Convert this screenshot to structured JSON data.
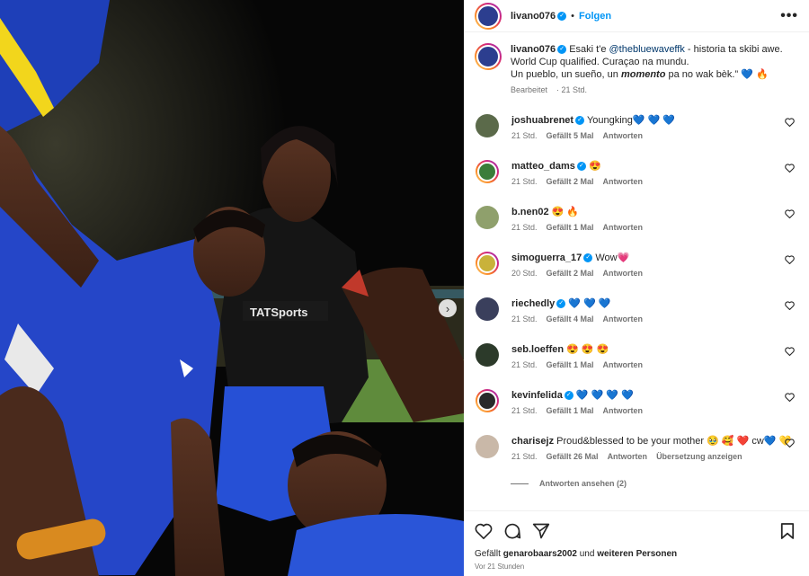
{
  "post": {
    "author": "livano076",
    "follow_label": "Folgen",
    "more_label": "•••",
    "caption": {
      "author": "livano076",
      "text_before": "Esaki t'e ",
      "mention": "@thebluewaveffk",
      "text_after": " - historia ta skibi awe. World Cup qualified. Curaçao na mundu.",
      "line3_before": "Un pueblo, un sueño, un ",
      "line3_em": "momento",
      "line3_after": " pa no wak bèk.” 💙 🔥",
      "meta_edited": "Bearbeitet",
      "meta_time": "21 Std."
    }
  },
  "comments": [
    {
      "user": "joshuabrenet",
      "verified": true,
      "text": "Youngking💙 💙 💙",
      "time": "21 Std.",
      "likes": "Gefällt 5 Mal",
      "reply": "Antworten",
      "avatar_color": "#5b6a4a",
      "ring": false
    },
    {
      "user": "matteo_dams",
      "verified": true,
      "text": "😍",
      "time": "21 Std.",
      "likes": "Gefällt 2 Mal",
      "reply": "Antworten",
      "avatar_color": "#3b7d3a",
      "ring": true
    },
    {
      "user": "b.nen02",
      "verified": false,
      "text": "😍 🔥",
      "time": "21 Std.",
      "likes": "Gefällt 1 Mal",
      "reply": "Antworten",
      "avatar_color": "#8fa06c",
      "ring": false
    },
    {
      "user": "simoguerra_17",
      "verified": true,
      "text": "Wow💗",
      "time": "20 Std.",
      "likes": "Gefällt 2 Mal",
      "reply": "Antworten",
      "avatar_color": "#c9b23a",
      "ring": true
    },
    {
      "user": "riechedly",
      "verified": true,
      "text": "💙 💙 💙",
      "time": "21 Std.",
      "likes": "Gefällt 4 Mal",
      "reply": "Antworten",
      "avatar_color": "#3a3f5c",
      "ring": false
    },
    {
      "user": "seb.loeffen",
      "verified": false,
      "text": "😍 😍 😍",
      "time": "21 Std.",
      "likes": "Gefällt 1 Mal",
      "reply": "Antworten",
      "avatar_color": "#2c3a2a",
      "ring": false
    },
    {
      "user": "kevinfelida",
      "verified": true,
      "text": "💙 💙 💙 💙",
      "time": "21 Std.",
      "likes": "Gefällt 1 Mal",
      "reply": "Antworten",
      "avatar_color": "#2a2a2a",
      "ring": true
    },
    {
      "user": "charisejz",
      "verified": false,
      "text": "Proud&blessed to be your mother 🥹 🥰 ❤️ cw💙 💛",
      "time": "21 Std.",
      "likes": "Gefällt 26 Mal",
      "reply": "Antworten",
      "translate": "Übersetzung anzeigen",
      "avatar_color": "#c9b8a8",
      "ring": false
    }
  ],
  "view_replies": "Antworten ansehen (2)",
  "footer": {
    "liked_prefix": "Gefällt ",
    "liked_user": "genarobaars2002",
    "liked_mid": " und ",
    "liked_rest": "weiteren Personen",
    "ago": "Vor 21 Stunden"
  },
  "icons": {
    "like": "heart-icon",
    "comment": "comment-icon",
    "share": "share-icon",
    "save": "bookmark-icon",
    "next": "chevron-right-icon"
  },
  "colors": {
    "accent": "#0095f6",
    "muted": "#737373",
    "text": "#262626",
    "jersey": "#1f46c9"
  }
}
